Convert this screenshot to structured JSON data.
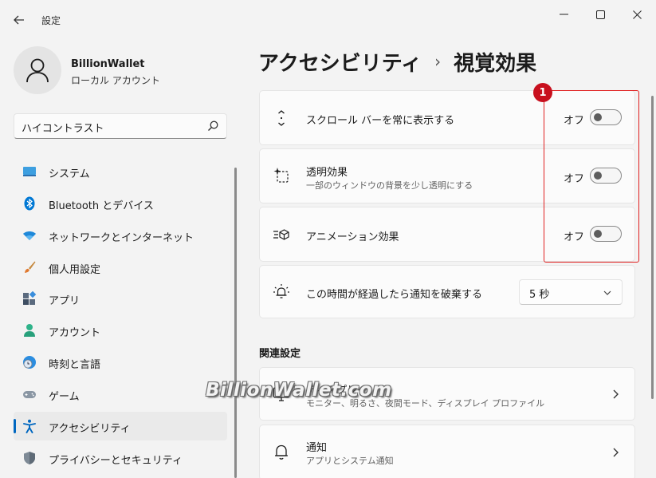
{
  "window": {
    "title": "設定",
    "controls": {
      "minimize": "minimize-icon",
      "maximize": "maximize-icon",
      "close": "close-icon"
    }
  },
  "account": {
    "name": "BillionWallet",
    "type": "ローカル アカウント"
  },
  "search": {
    "value": "ハイコントラスト",
    "icon": "search-icon"
  },
  "sidebar": {
    "items": [
      {
        "label": "システム",
        "icon": "system-icon"
      },
      {
        "label": "Bluetooth とデバイス",
        "icon": "bluetooth-icon"
      },
      {
        "label": "ネットワークとインターネット",
        "icon": "wifi-icon"
      },
      {
        "label": "個人用設定",
        "icon": "brush-icon"
      },
      {
        "label": "アプリ",
        "icon": "apps-icon"
      },
      {
        "label": "アカウント",
        "icon": "person-icon"
      },
      {
        "label": "時刻と言語",
        "icon": "globe-clock-icon"
      },
      {
        "label": "ゲーム",
        "icon": "gamepad-icon"
      },
      {
        "label": "アクセシビリティ",
        "icon": "accessibility-icon",
        "active": true
      },
      {
        "label": "プライバシーとセキュリティ",
        "icon": "shield-icon"
      }
    ]
  },
  "breadcrumb": {
    "parent": "アクセシビリティ",
    "separator": "›",
    "current": "視覚効果"
  },
  "settings": {
    "scrollbars": {
      "title": "スクロール バーを常に表示する",
      "state": "オフ",
      "icon": "scroll-arrows-icon"
    },
    "transparency": {
      "title": "透明効果",
      "subtitle": "一部のウィンドウの背景を少し透明にする",
      "state": "オフ",
      "icon": "transparency-icon"
    },
    "animation": {
      "title": "アニメーション効果",
      "state": "オフ",
      "icon": "animation-icon"
    },
    "notifications": {
      "title": "この時間が経過したら通知を破棄する",
      "value": "5 秒",
      "icon": "sun-bell-icon"
    }
  },
  "related": {
    "heading": "関連設定",
    "display": {
      "title": "ディスプレイ",
      "subtitle": "モニター、明るさ、夜間モード、ディスプレイ プロファイル",
      "icon": "monitor-icon"
    },
    "notify": {
      "title": "通知",
      "subtitle": "アプリとシステム通知",
      "icon": "bell-icon"
    }
  },
  "annotation": {
    "badge": "1"
  },
  "watermark": "BillionWallet.com",
  "colors": {
    "accent": "#0067c0",
    "highlight": "#e02020",
    "badge": "#c8101e"
  }
}
